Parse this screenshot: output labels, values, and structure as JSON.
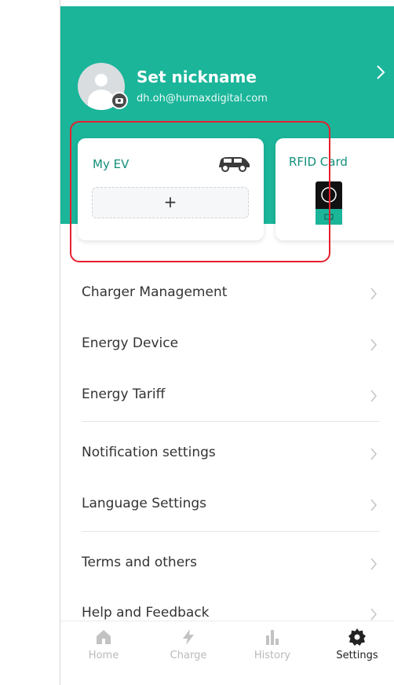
{
  "profile": {
    "nickname": "Set nickname",
    "email": "dh.oh@humaxdigital.com"
  },
  "cards": {
    "my_ev_label": "My EV",
    "add_ev_symbol": "+",
    "rfid_label": "RFID Card"
  },
  "menu": {
    "items": [
      {
        "label": "Charger Management"
      },
      {
        "label": "Energy Device"
      },
      {
        "label": "Energy Tariff"
      },
      {
        "label": "Notification settings"
      },
      {
        "label": "Language Settings"
      },
      {
        "label": "Terms and others"
      },
      {
        "label": "Help and Feedback"
      }
    ]
  },
  "tabbar": {
    "tabs": [
      {
        "label": "Home",
        "icon": "home-icon",
        "active": false
      },
      {
        "label": "Charge",
        "icon": "lightning-icon",
        "active": false
      },
      {
        "label": "History",
        "icon": "bar-chart-icon",
        "active": false
      },
      {
        "label": "Settings",
        "icon": "gear-icon",
        "active": true
      }
    ]
  },
  "colors": {
    "accent": "#1bb59a",
    "accent_text": "#138f7a",
    "highlight": "#e5202f"
  }
}
